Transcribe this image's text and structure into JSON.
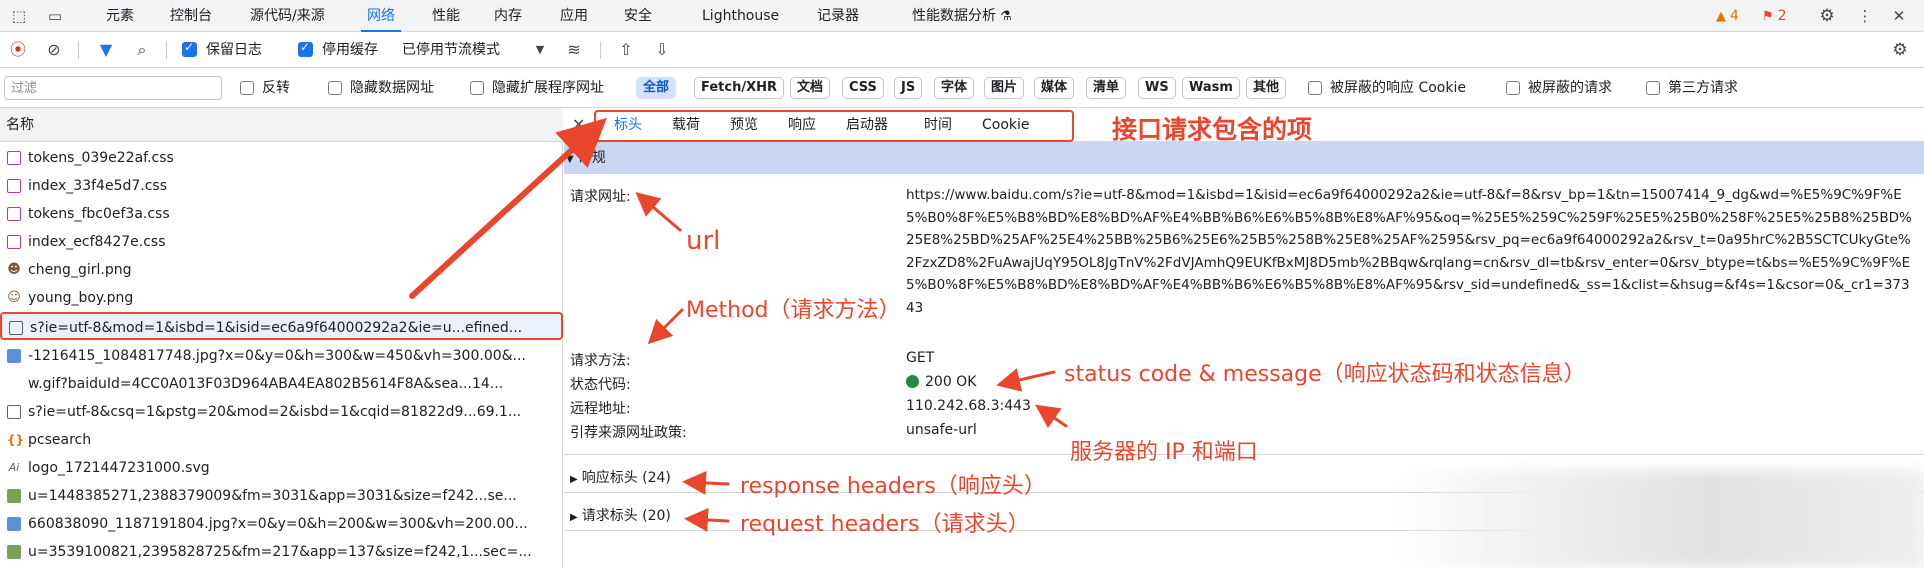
{
  "tabbar": {
    "tabs": [
      "元素",
      "控制台",
      "源代码/来源",
      "网络",
      "性能",
      "内存",
      "应用",
      "安全",
      "Lighthouse",
      "记录器",
      "性能数据分析"
    ],
    "active_tab": "网络",
    "warnings_count": "4",
    "issues_count": "2"
  },
  "toolbar": {
    "preserve_log": "保留日志",
    "disable_cache": "停用缓存",
    "throttling": "已停用节流模式"
  },
  "filterbar": {
    "filter_placeholder": "过滤",
    "invert": "反转",
    "hide_data_urls": "隐藏数据网址",
    "hide_extension_urls": "隐藏扩展程序网址",
    "types": [
      "全部",
      "Fetch/XHR",
      "文档",
      "CSS",
      "JS",
      "字体",
      "图片",
      "媒体",
      "清单",
      "WS",
      "Wasm",
      "其他"
    ],
    "active_type": "全部",
    "blocked_response_cookies": "被屏蔽的响应 Cookie",
    "blocked_requests": "被屏蔽的请求",
    "third_party_requests": "第三方请求"
  },
  "request_list": {
    "header": "名称",
    "rows": [
      {
        "name": "tokens_039e22af.css",
        "icon": "css-file-icon"
      },
      {
        "name": "index_33f4e5d7.css",
        "icon": "css-file-icon"
      },
      {
        "name": "tokens_fbc0ef3a.css",
        "icon": "css-file-icon"
      },
      {
        "name": "index_ecf8427e.css",
        "icon": "css-file-icon"
      },
      {
        "name": "cheng_girl.png",
        "icon": "image-thumbnail-icon"
      },
      {
        "name": "young_boy.png",
        "icon": "image-thumbnail-icon"
      },
      {
        "name": "s?ie=utf-8&mod=1&isbd=1&isid=ec6a9f64000292a2&ie=u...efined...",
        "icon": "document-icon"
      },
      {
        "name": "-1216415_1084817748.jpg?x=0&y=0&h=300&w=450&vh=300.00&...",
        "icon": "image-icon"
      },
      {
        "name": "w.gif?baiduId=4CC0A013F03D964ABA4EA802B5614F8A&sea...14...",
        "icon": "none"
      },
      {
        "name": "s?ie=utf-8&csq=1&pstg=20&mod=2&isbd=1&cqid=81822d9...69.1...",
        "icon": "document-icon"
      },
      {
        "name": "pcsearch",
        "icon": "script-icon"
      },
      {
        "name": "logo_1721447231000.svg",
        "icon": "svg-file-icon"
      },
      {
        "name": "u=1448385271,2388379009&fm=3031&app=3031&size=f242...se...",
        "icon": "image-icon-green"
      },
      {
        "name": "660838090_1187191804.jpg?x=0&y=0&h=200&w=300&vh=200.00...",
        "icon": "image-icon"
      },
      {
        "name": "u=3539100821,2395828725&fm=217&app=137&size=f242,1...sec=...",
        "icon": "image-icon-green"
      }
    ],
    "selected_index": 6
  },
  "details": {
    "tabs": [
      "标头",
      "载荷",
      "预览",
      "响应",
      "启动器",
      "时间",
      "Cookie"
    ],
    "active_tab": "标头",
    "general_title": "常规",
    "request_url_label": "请求网址:",
    "request_url": "https://www.baidu.com/s?ie=utf-8&mod=1&isbd=1&isid=ec6a9f64000292a2&ie=utf-8&f=8&rsv_bp=1&tn=15007414_9_dg&wd=%E5%9C%9F%E5%B0%8F%E5%B8%BD%E8%BD%AF%E4%BB%B6%E6%B5%8B%E8%AF%95&oq=%25E5%259C%259F%25E5%25B0%258F%25E5%25B8%25BD%25E8%25BD%25AF%25E4%25BB%25B6%25E6%25B5%258B%25E8%25AF%2595&rsv_pq=ec6a9f64000292a2&rsv_t=0a95hrC%2B5SCTCUkyGte%2FzxZD8%2FuAwajUqY95OL8JgTnV%2FdVJAmhQ9EUKfBxMJ8D5mb%2BBqw&rqlang=cn&rsv_dl=tb&rsv_enter=0&rsv_btype=t&bs=%E5%9C%9F%E5%B0%8F%E5%B8%BD%E8%BD%AF%E4%BB%B6%E6%B5%8B%E8%AF%95&rsv_sid=undefined&_ss=1&clist=&hsug=&f4s=1&csor=0&_cr1=37343",
    "method_label": "请求方法:",
    "method": "GET",
    "status_label": "状态代码:",
    "status": "200 OK",
    "status_color": "#1e8e3e",
    "remote_label": "远程地址:",
    "remote": "110.242.68.3:443",
    "referrer_label": "引荐来源网址政策:",
    "referrer": "unsafe-url",
    "response_headers": "响应标头 (24)",
    "request_headers": "请求标头 (20)"
  },
  "annotations": {
    "tabs_note": "接口请求包含的项",
    "url_note": "url",
    "method_note": "Method（请求方法）",
    "status_note": "status code & message（响应状态码和状态信息）",
    "remote_note": "服务器的 IP 和端口",
    "resp_note": "response headers（响应头）",
    "req_note": "request headers（请求头）",
    "color": "#e8472d"
  }
}
